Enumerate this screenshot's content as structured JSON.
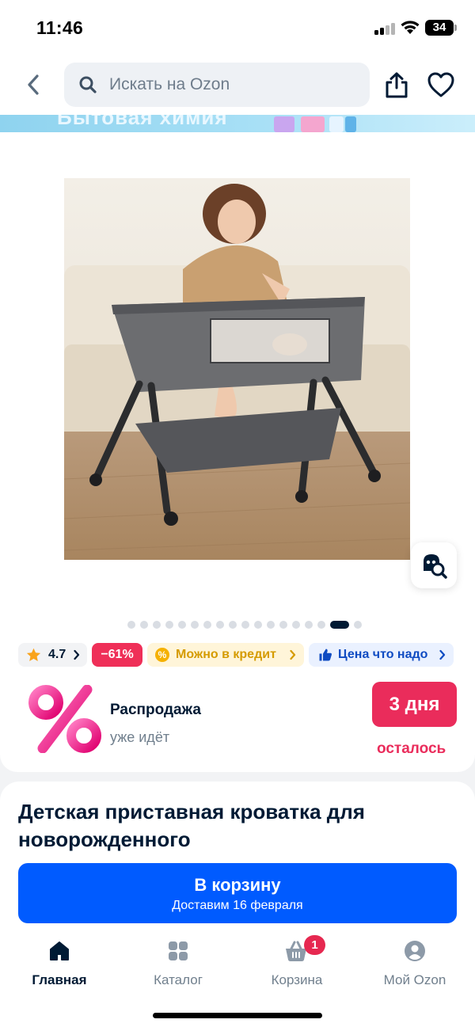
{
  "status_bar": {
    "time": "11:46",
    "battery": "34"
  },
  "search": {
    "placeholder": "Искать на Ozon"
  },
  "banner": {
    "text": "Бытовая химия"
  },
  "gallery": {
    "image_count": 18,
    "active_index": 16
  },
  "chips": {
    "rating": "4.7",
    "discount": "−61%",
    "credit": "Можно в кредит",
    "price": "Цена что надо"
  },
  "promo": {
    "title": "Распродажа",
    "subtitle": "уже идёт",
    "days": "3 дня",
    "remaining": "осталось"
  },
  "product": {
    "title": "Детская приставная кроватка для новорожденного"
  },
  "cart_button": {
    "label": "В корзину",
    "delivery": "Доставим 16 февраля"
  },
  "tabs": [
    {
      "label": "Главная",
      "icon": "home-icon"
    },
    {
      "label": "Каталог",
      "icon": "catalog-icon"
    },
    {
      "label": "Корзина",
      "icon": "cart-icon",
      "badge": "1"
    },
    {
      "label": "Мой Ozon",
      "icon": "profile-icon"
    }
  ],
  "colors": {
    "brand_blue": "#005bff",
    "promo_red": "#ea2c5b",
    "discount_red": "#ef2f58",
    "credit_yellow": "#f5b100"
  }
}
